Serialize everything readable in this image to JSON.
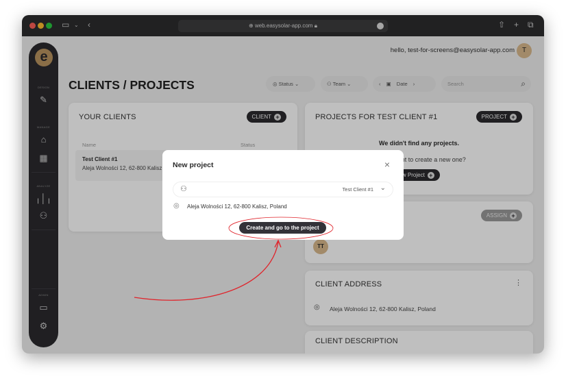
{
  "browser": {
    "url": "web.easysolar-app.com"
  },
  "header": {
    "greeting": "hello, test-for-screens@easysolar-app.com",
    "avatar_initial": "T"
  },
  "sidebar": {
    "logo": "e",
    "sections": [
      {
        "label": "DESIGN",
        "icons": [
          "edit-icon"
        ]
      },
      {
        "label": "MANAGE",
        "icons": [
          "home-icon",
          "solar-panel-icon"
        ]
      },
      {
        "label": "ANALYZE",
        "icons": [
          "bar-chart-icon",
          "users-icon"
        ]
      },
      {
        "label": "ADMIN",
        "icons": [
          "card-icon",
          "settings-icon"
        ]
      }
    ]
  },
  "page": {
    "title": "CLIENTS / PROJECTS"
  },
  "filters": {
    "status": "Status",
    "team": "Team",
    "date": "Date",
    "search_placeholder": "Search"
  },
  "clients": {
    "title": "YOUR CLIENTS",
    "add_label": "CLIENT",
    "columns": [
      "Name",
      "Status"
    ],
    "rows": [
      {
        "name": "Test Client #1",
        "address": "Aleja Wolności 12, 62-800 Kalisz, Poland"
      }
    ]
  },
  "projects": {
    "title": "PROJECTS FOR TEST CLIENT #1",
    "add_label": "PROJECT",
    "empty_title": "We didn't find any projects.",
    "empty_question": "Do you want to create a new one?",
    "create_label": "new Project"
  },
  "team": {
    "assign_label": "ASSIGN",
    "member_initials": "TT"
  },
  "address": {
    "title": "CLIENT ADDRESS",
    "value": "Aleja Wolności 12, 62-800 Kalisz, Poland"
  },
  "description": {
    "title": "CLIENT DESCRIPTION"
  },
  "modal": {
    "title": "New project",
    "client_value": "Test Client #1",
    "address": "Aleja Wolności 12, 62-800 Kalisz, Poland",
    "submit_label": "Create and go to the project"
  },
  "colors": {
    "accent": "#b9935f",
    "dark": "#2b2a2e",
    "annotation": "#e0242b"
  }
}
